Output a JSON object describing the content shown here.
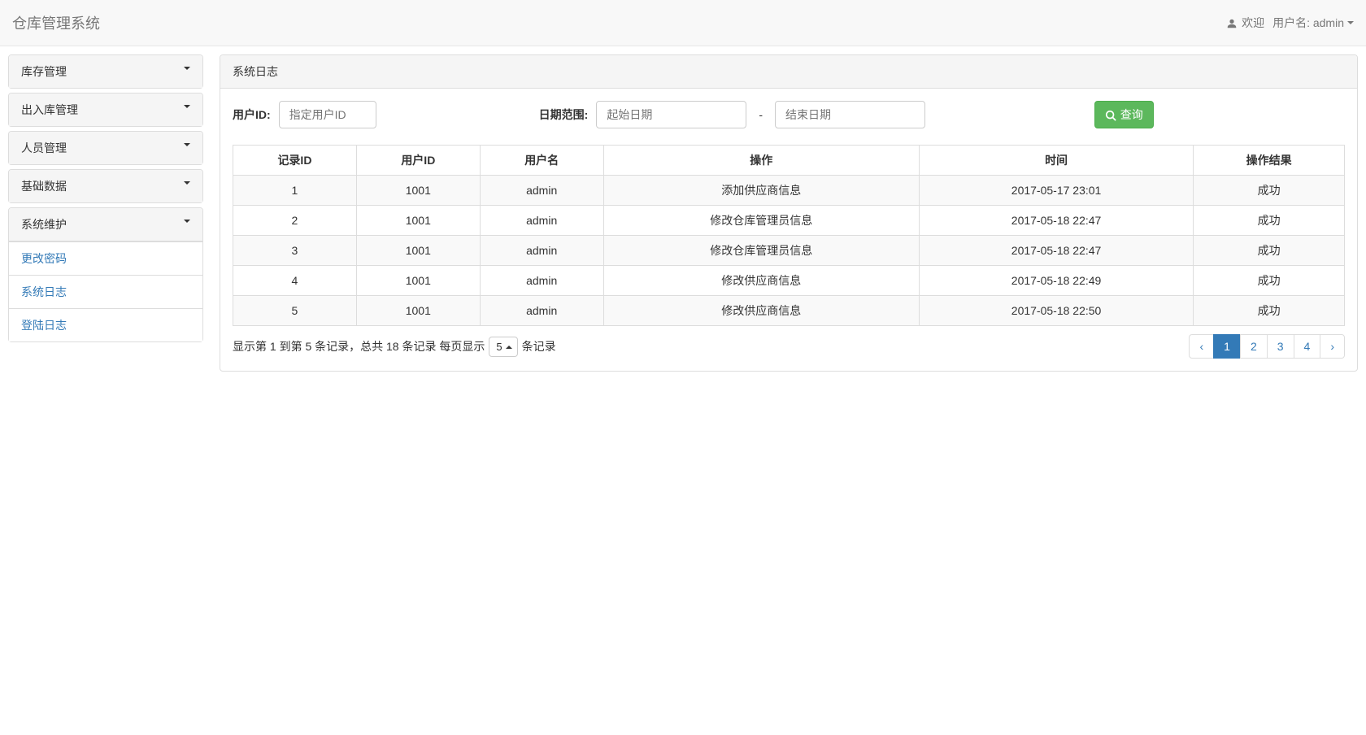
{
  "navbar": {
    "brand": "仓库管理系统",
    "welcome": "欢迎",
    "username_label": "用户名: admin"
  },
  "sidebar": {
    "items": [
      {
        "label": "库存管理",
        "expanded": false
      },
      {
        "label": "出入库管理",
        "expanded": false
      },
      {
        "label": "人员管理",
        "expanded": false
      },
      {
        "label": "基础数据",
        "expanded": false
      },
      {
        "label": "系统维护",
        "expanded": true,
        "children": [
          {
            "label": "更改密码"
          },
          {
            "label": "系统日志"
          },
          {
            "label": "登陆日志"
          }
        ]
      }
    ]
  },
  "panel": {
    "title": "系统日志",
    "search": {
      "user_id_label": "用户ID:",
      "user_id_placeholder": "指定用户ID",
      "date_range_label": "日期范围:",
      "start_date_placeholder": "起始日期",
      "end_date_placeholder": "结束日期",
      "date_separator": "-",
      "query_button": "查询"
    },
    "table": {
      "headers": [
        "记录ID",
        "用户ID",
        "用户名",
        "操作",
        "时间",
        "操作结果"
      ],
      "rows": [
        {
          "record_id": "1",
          "user_id": "1001",
          "username": "admin",
          "operation": "添加供应商信息",
          "time": "2017-05-17 23:01",
          "result": "成功"
        },
        {
          "record_id": "2",
          "user_id": "1001",
          "username": "admin",
          "operation": "修改仓库管理员信息",
          "time": "2017-05-18 22:47",
          "result": "成功"
        },
        {
          "record_id": "3",
          "user_id": "1001",
          "username": "admin",
          "operation": "修改仓库管理员信息",
          "time": "2017-05-18 22:47",
          "result": "成功"
        },
        {
          "record_id": "4",
          "user_id": "1001",
          "username": "admin",
          "operation": "修改供应商信息",
          "time": "2017-05-18 22:49",
          "result": "成功"
        },
        {
          "record_id": "5",
          "user_id": "1001",
          "username": "admin",
          "operation": "修改供应商信息",
          "time": "2017-05-18 22:50",
          "result": "成功"
        }
      ]
    },
    "pagination": {
      "info_text": "显示第 1 到第 5 条记录，总共 18 条记录 每页显示",
      "page_size": "5",
      "info_suffix": "条记录",
      "prev": "‹",
      "next": "›",
      "pages": [
        "1",
        "2",
        "3",
        "4"
      ],
      "current_page": "1"
    }
  }
}
